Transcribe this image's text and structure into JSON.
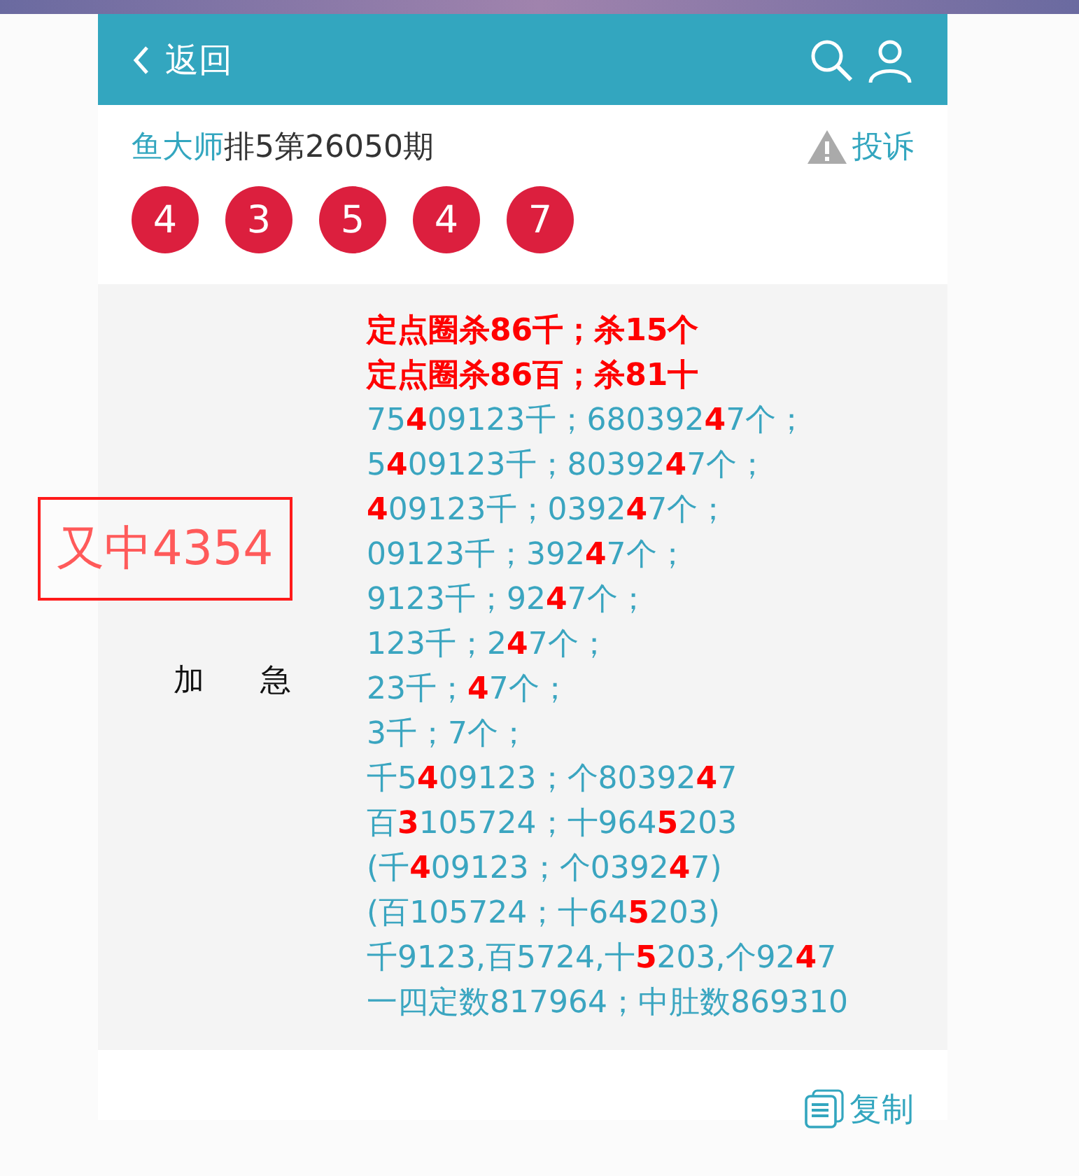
{
  "header": {
    "back_label": "返回"
  },
  "title": {
    "author": "鱼大师",
    "issue": "排5第26050期"
  },
  "complaint": "投诉",
  "balls": [
    "4",
    "3",
    "5",
    "4",
    "7"
  ],
  "stamp": "又中4354",
  "tag": [
    "加",
    "急"
  ],
  "lines": [
    {
      "kind": "headline",
      "text": "定点圈杀86千；杀15个"
    },
    {
      "kind": "headline",
      "text": "定点圈杀86百；杀81十"
    },
    {
      "kind": "plain",
      "text": "75**4**09123千；680392**4**7个；"
    },
    {
      "kind": "plain",
      "text": "5**4**09123千；80392**4**7个；"
    },
    {
      "kind": "plain",
      "text": "**4**09123千；0392**4**7个；"
    },
    {
      "kind": "plain",
      "text": "09123千；392**4**7个；"
    },
    {
      "kind": "plain",
      "text": "9123千；92**4**7个；"
    },
    {
      "kind": "plain",
      "text": "123千；2**4**7个；"
    },
    {
      "kind": "plain",
      "text": "23千；**4**7个；"
    },
    {
      "kind": "plain",
      "text": "3千；7个；"
    },
    {
      "kind": "plain",
      "text": "千5**4**09123；个80392**4**7"
    },
    {
      "kind": "plain",
      "text": "百**3**105724；十964**5**203"
    },
    {
      "kind": "plain",
      "text": "(千**4**09123；个0392**4**7)"
    },
    {
      "kind": "plain",
      "text": "(百105724；十64**5**203)"
    },
    {
      "kind": "plain",
      "text": "千9123,百5724,十**5**203,个92**4**7"
    },
    {
      "kind": "plain",
      "text": "一四定数817964；中肚数869310"
    }
  ],
  "copy_label": "复制"
}
